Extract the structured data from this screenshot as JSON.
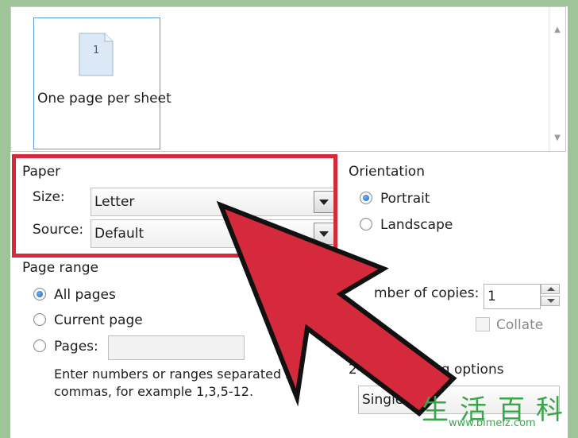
{
  "layout": {
    "page_number": "1",
    "option_label": "One page per sheet"
  },
  "paper": {
    "section_label": "Paper",
    "size_label": "Size:",
    "size_value": "Letter",
    "source_label": "Source:",
    "source_value": "Default"
  },
  "orientation": {
    "section_label": "Orientation",
    "options": [
      {
        "label": "Portrait",
        "selected": true
      },
      {
        "label": "Landscape",
        "selected": false
      }
    ]
  },
  "page_range": {
    "section_label": "Page range",
    "options": [
      {
        "label": "All pages",
        "selected": true
      },
      {
        "label": "Current page",
        "selected": false
      },
      {
        "label": "Pages:",
        "selected": false
      }
    ],
    "hint_line1": "Enter numbers or ranges separated by",
    "hint_line2": "commas, for example 1,3,5-12."
  },
  "copies": {
    "label": "mber of copies:",
    "value": "1",
    "collate_label": "Collate"
  },
  "two_sided": {
    "label_start": "2-side",
    "label_end": "ng options",
    "value": "Single-sid"
  },
  "watermark": {
    "chars": "生活百科",
    "url": "www.bimeiz.com"
  },
  "colors": {
    "highlight": "#d52a3c",
    "arrow": "#d52a3c",
    "selection_blue": "#5b9bd5"
  }
}
